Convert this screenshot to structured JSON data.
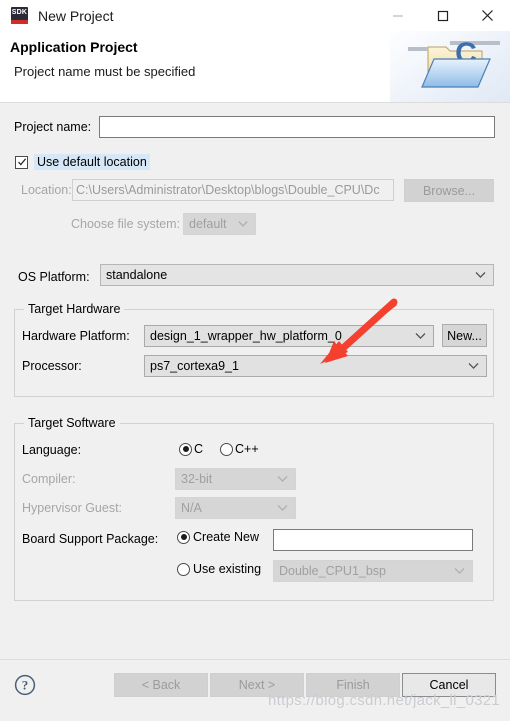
{
  "window": {
    "title": "New Project",
    "app_icon_label": "SDK",
    "minimize_label": "Minimize",
    "maximize_label": "Maximize",
    "close_label": "Close"
  },
  "header": {
    "title": "Application Project",
    "subtitle": "Project name must be specified"
  },
  "form": {
    "project_name_label": "Project name:",
    "project_name_value": "",
    "use_default_location_label": "Use default location",
    "use_default_location_checked": true,
    "location_label": "Location:",
    "location_value": "C:\\Users\\Administrator\\Desktop\\blogs\\Double_CPU\\Dc",
    "browse_label": "Browse...",
    "choose_file_system_label": "Choose file system:",
    "choose_file_system_value": "default",
    "os_platform_label": "OS Platform:",
    "os_platform_value": "standalone"
  },
  "target_hardware": {
    "group_title": "Target Hardware",
    "hardware_platform_label": "Hardware Platform:",
    "hardware_platform_value": "design_1_wrapper_hw_platform_0",
    "new_label": "New...",
    "processor_label": "Processor:",
    "processor_value": "ps7_cortexa9_1"
  },
  "target_software": {
    "group_title": "Target Software",
    "language_label": "Language:",
    "language_option_c": "C",
    "language_option_cpp": "C++",
    "language_selected": "C",
    "compiler_label": "Compiler:",
    "compiler_value": "32-bit",
    "hypervisor_label": "Hypervisor Guest:",
    "hypervisor_value": "N/A",
    "bsp_label": "Board Support Package:",
    "bsp_create_new_label": "Create New",
    "bsp_create_new_value": "",
    "bsp_use_existing_label": "Use existing",
    "bsp_use_existing_value": "Double_CPU1_bsp",
    "bsp_selected": "Create New"
  },
  "footer": {
    "help_label": "?",
    "back_label": "< Back",
    "next_label": "Next >",
    "finish_label": "Finish",
    "cancel_label": "Cancel"
  },
  "overlay": {
    "watermark": "https://blog.csdn.net/jack_ll_0321",
    "arrow_color": "#f4402e"
  }
}
